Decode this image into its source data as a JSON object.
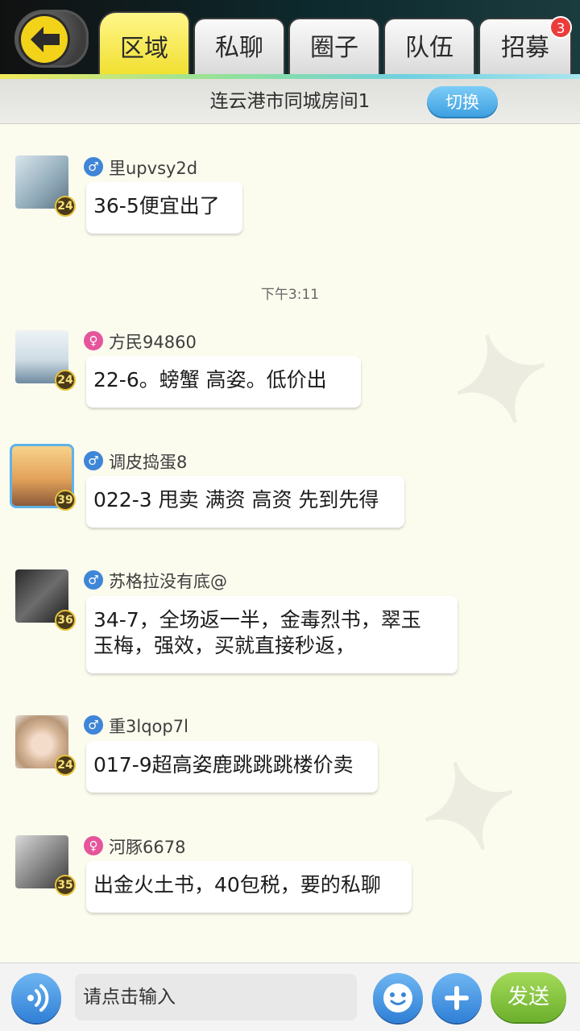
{
  "header": {
    "tabs": [
      {
        "label": "区域",
        "active": true
      },
      {
        "label": "私聊",
        "active": false
      },
      {
        "label": "圈子",
        "active": false
      },
      {
        "label": "队伍",
        "active": false
      },
      {
        "label": "招募",
        "active": false
      }
    ],
    "recruit_badge": "3"
  },
  "room": {
    "title": "连云港市同城房间1",
    "switch_label": "切换"
  },
  "messages": [
    {
      "gender": "male",
      "username": "里upvsy2d",
      "level": "24",
      "text": "36-5便宜出了"
    },
    {
      "gender": "female",
      "username": "方民94860",
      "level": "24",
      "text": "22-6。螃蟹 高姿。低价出"
    },
    {
      "gender": "male",
      "username": "调皮捣蛋8",
      "level": "39",
      "text": "022-3 甩卖 满资 高资 先到先得"
    },
    {
      "gender": "male",
      "username": "苏格拉没有底@",
      "level": "36",
      "text_line1": "34-7，全场返一半，金毒烈书，翠玉",
      "text_line2": "玉梅，强效，买就直接秒返，"
    },
    {
      "gender": "male",
      "username": "重3lqop7l",
      "level": "24",
      "text": "017-9超高姿鹿跳跳跳楼价卖"
    },
    {
      "gender": "female",
      "username": "河豚6678",
      "level": "35",
      "text": "出金火土书，40包税，要的私聊"
    }
  ],
  "timestamp": "下午3:11",
  "input": {
    "placeholder": "请点击输入",
    "send_label": "发送"
  },
  "colors": {
    "tab_active": "#f1df2f",
    "accent_blue": "#3b9ddf",
    "send_green": "#6cb02c",
    "badge_red": "#ec3b3b"
  }
}
